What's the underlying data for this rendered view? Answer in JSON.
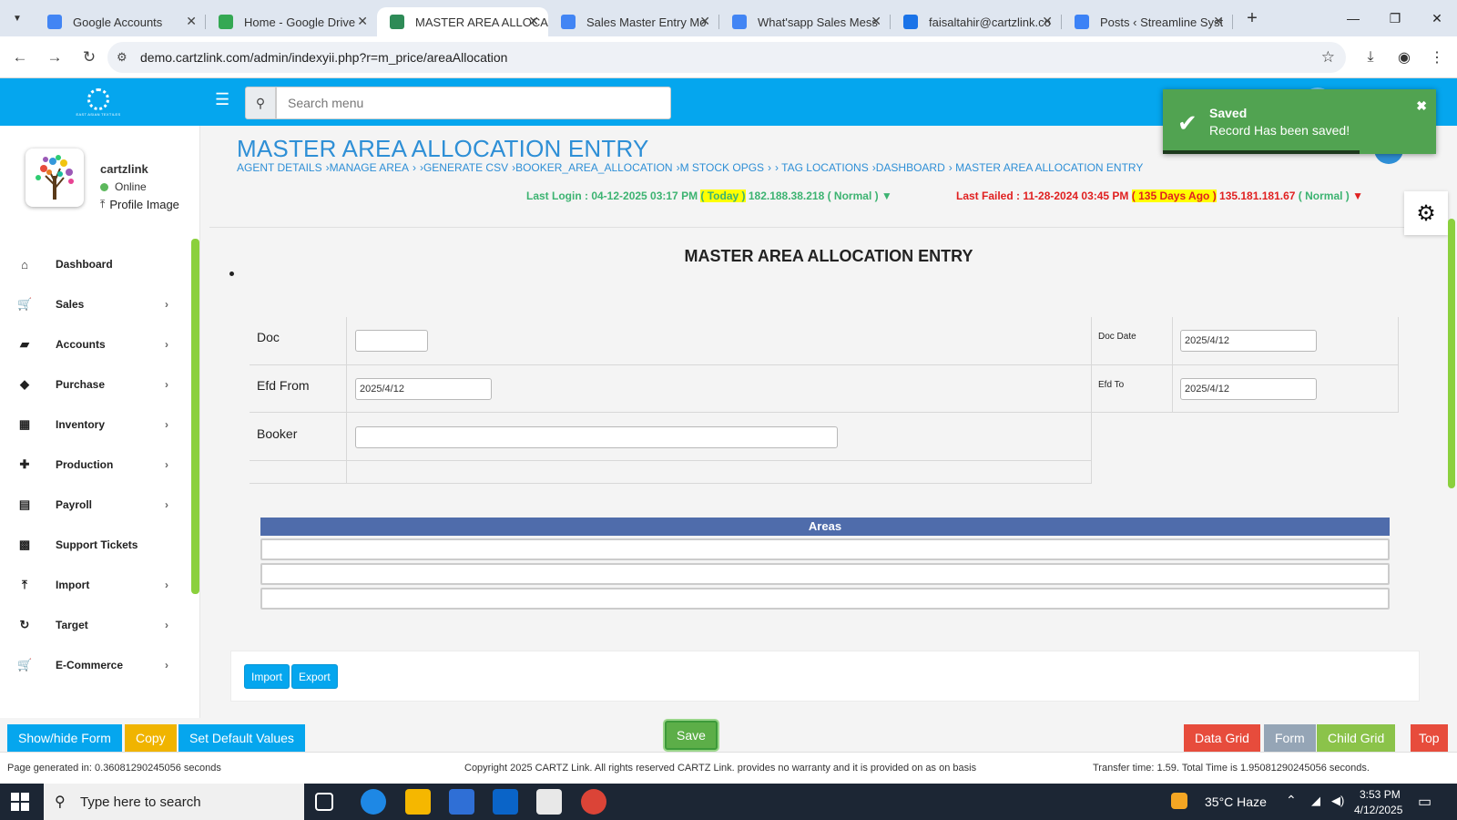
{
  "browser": {
    "tabs": [
      {
        "title": "Google Accounts",
        "color": "#4285f4"
      },
      {
        "title": "Home - Google Drive",
        "color": "#34a853"
      },
      {
        "title": "MASTER AREA ALLOCA",
        "color": "#2e8b57"
      },
      {
        "title": "Sales Master Entry Mo",
        "color": "#4285f4"
      },
      {
        "title": "What'sapp Sales Mess",
        "color": "#4285f4"
      },
      {
        "title": "faisaltahir@cartzlink.co",
        "color": "#1a73e8"
      },
      {
        "title": "Posts ‹ Streamline Syst",
        "color": "#3c82f6"
      }
    ],
    "url": "demo.cartzlink.com/admin/indexyii.php?r=m_price/areaAllocation"
  },
  "header": {
    "logo_text": "EAST ASIAN TEXTILES",
    "search_placeholder": "Search menu"
  },
  "profile": {
    "name": "cartzlink",
    "status": "Online",
    "image_link": "Profile Image"
  },
  "sidebar": {
    "items": [
      {
        "label": "Dashboard",
        "icon": "home-icon",
        "glyph": "⌂",
        "has_children": false
      },
      {
        "label": "Sales",
        "icon": "cart-icon",
        "glyph": "🛒",
        "has_children": true
      },
      {
        "label": "Accounts",
        "icon": "briefcase-icon",
        "glyph": "▰",
        "has_children": true
      },
      {
        "label": "Purchase",
        "icon": "tags-icon",
        "glyph": "◆",
        "has_children": true
      },
      {
        "label": "Inventory",
        "icon": "grid-icon",
        "glyph": "▦",
        "has_children": true
      },
      {
        "label": "Production",
        "icon": "puzzle-icon",
        "glyph": "✚",
        "has_children": true
      },
      {
        "label": "Payroll",
        "icon": "money-icon",
        "glyph": "▤",
        "has_children": true
      },
      {
        "label": "Support Tickets",
        "icon": "ticket-icon",
        "glyph": "▩",
        "has_children": false
      },
      {
        "label": "Import",
        "icon": "upload-icon",
        "glyph": "⤒",
        "has_children": true
      },
      {
        "label": "Target",
        "icon": "refresh-icon",
        "glyph": "↻",
        "has_children": true
      },
      {
        "label": "E-Commerce",
        "icon": "cart-icon",
        "glyph": "🛒",
        "has_children": true
      }
    ]
  },
  "page": {
    "title": "MASTER AREA ALLOCATION ENTRY",
    "breadcrumb": [
      "AGENT DETAILS",
      "›MANAGE AREA",
      "›",
      "›GENERATE CSV",
      "›BOOKER_AREA_ALLOCATION",
      "›M STOCK OPGS",
      "›",
      "› TAG LOCATIONS",
      "›DASHBOARD",
      "› MASTER AREA ALLOCATION ENTRY"
    ],
    "last_login": {
      "prefix": "Last Login : 04-12-2025 03:17 PM ",
      "highlight": "( Today )",
      "suffix": " 182.188.38.218 ( Normal ) ▼"
    },
    "last_failed": {
      "prefix": "Last Failed : 11-28-2024 03:45 PM ",
      "highlight": "( 135 Days Ago )",
      "ip": " 135.181.181.67 ",
      "normal": "( Normal )",
      "arrow": " ▼"
    },
    "form_heading": "MASTER AREA ALLOCATION ENTRY"
  },
  "form": {
    "doc_label": "Doc",
    "doc_value": "",
    "doc_date_label": "Doc Date",
    "doc_date_value": "2025/4/12",
    "efd_from_label": "Efd From",
    "efd_from_value": "2025/4/12",
    "efd_to_label": "Efd To",
    "efd_to_value": "2025/4/12",
    "booker_label": "Booker",
    "booker_value": ""
  },
  "areas": {
    "header": "Areas",
    "rows": [
      "",
      "",
      ""
    ]
  },
  "actions": {
    "import": "Import",
    "export": "Export",
    "show_hide_form": "Show/hide Form",
    "copy": "Copy",
    "set_default": "Set Default Values",
    "save": "Save",
    "data_grid": "Data Grid",
    "form": "Form",
    "child_grid": "Child Grid",
    "top": "Top"
  },
  "colors": {
    "header_blue": "#05a6ee",
    "copy_yellow": "#f0b400",
    "data_grid_red": "#e74c3c",
    "form_grey": "#95a5b6",
    "child_grid_green": "#8bc34a",
    "top_red": "#e74c3c"
  },
  "footer": {
    "generated": "Page generated in: 0.36081290245056 seconds",
    "copyright": "Copyright 2025 CARTZ Link. All rights reserved CARTZ Link. provides no warranty and it is provided on as on basis",
    "transfer": "Transfer time: 1.59. Total Time is 1.95081290245056 seconds."
  },
  "toast": {
    "title": "Saved",
    "message": "Record Has been saved!",
    "progress_fraction": 0.72
  },
  "taskbar": {
    "search_text": "Type here to search",
    "weather": "35°C  Haze",
    "time": "3:53 PM",
    "date": "4/12/2025",
    "notification_count": "1"
  }
}
